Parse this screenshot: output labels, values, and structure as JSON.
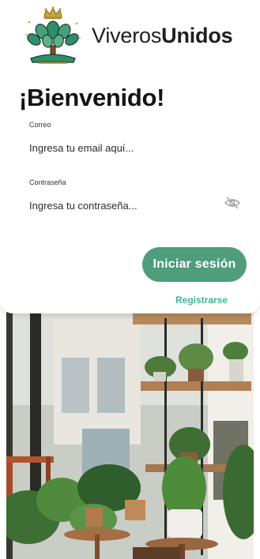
{
  "brand": {
    "name_regular": "Viveros",
    "name_bold": "Unidos"
  },
  "login": {
    "title": "¡Bienvenido!",
    "email_label": "Correo",
    "email_placeholder": "Ingresa tu email aquí...",
    "password_label": "Contraseña",
    "password_placeholder": "Ingresa tu contraseña...",
    "password_toggle_icon": "eye-off-icon",
    "submit_label": "Iniciar sesión",
    "register_label": "Registrarse"
  },
  "colors": {
    "primary_button": "#4f9d7a",
    "link": "#3fb59a"
  },
  "photo": {
    "subject": "indoor plant shop interior"
  }
}
